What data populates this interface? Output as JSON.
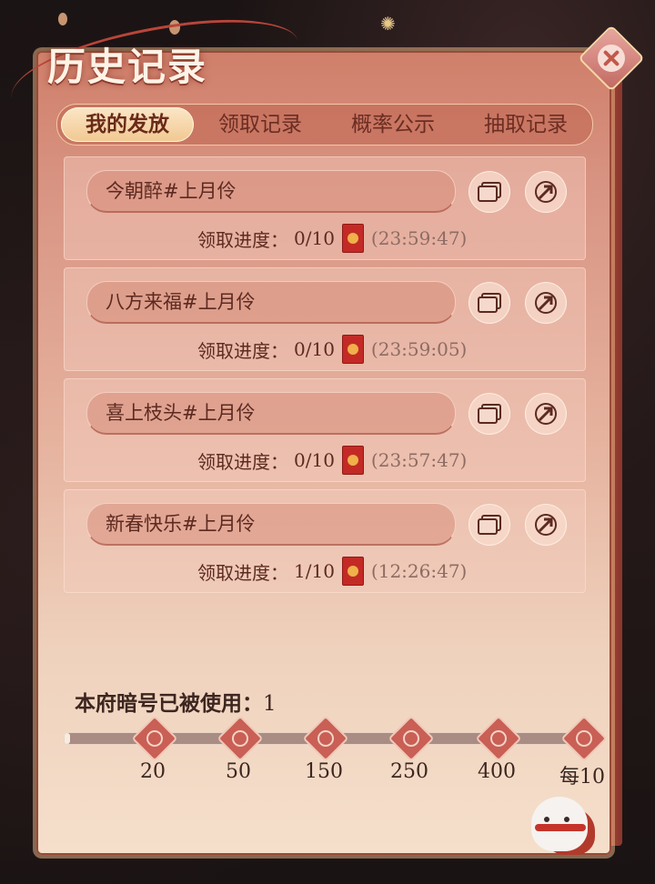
{
  "header": {
    "title": "历史记录"
  },
  "tabs": [
    {
      "label": "我的发放",
      "active": true
    },
    {
      "label": "领取记录",
      "active": false
    },
    {
      "label": "概率公示",
      "active": false
    },
    {
      "label": "抽取记录",
      "active": false
    }
  ],
  "records": [
    {
      "name": "今朝醉#上月伶",
      "progress_label": "领取进度：",
      "progress": "0/10",
      "time": "(23:59:47)",
      "copy_icon": "copy-icon",
      "share_icon": "share-icon"
    },
    {
      "name": "八方来福#上月伶",
      "progress_label": "领取进度：",
      "progress": "0/10",
      "time": "(23:59:05)",
      "copy_icon": "copy-icon",
      "share_icon": "share-icon"
    },
    {
      "name": "喜上枝头#上月伶",
      "progress_label": "领取进度：",
      "progress": "0/10",
      "time": "(23:57:47)",
      "copy_icon": "copy-icon",
      "share_icon": "share-icon"
    },
    {
      "name": "新春快乐#上月伶",
      "progress_label": "领取进度：",
      "progress": "1/10",
      "time": "(12:26:47)",
      "copy_icon": "copy-icon",
      "share_icon": "share-icon"
    }
  ],
  "usage": {
    "label": "本府暗号已被使用：",
    "count": "1",
    "milestones": [
      "20",
      "50",
      "150",
      "250",
      "400",
      "每10"
    ],
    "fill_fraction": 0.01
  },
  "colors": {
    "accent": "#c95f55",
    "panel_top": "#cf7f6a",
    "panel_bottom": "#f5dfcb",
    "text_dark": "#5c2a20"
  }
}
